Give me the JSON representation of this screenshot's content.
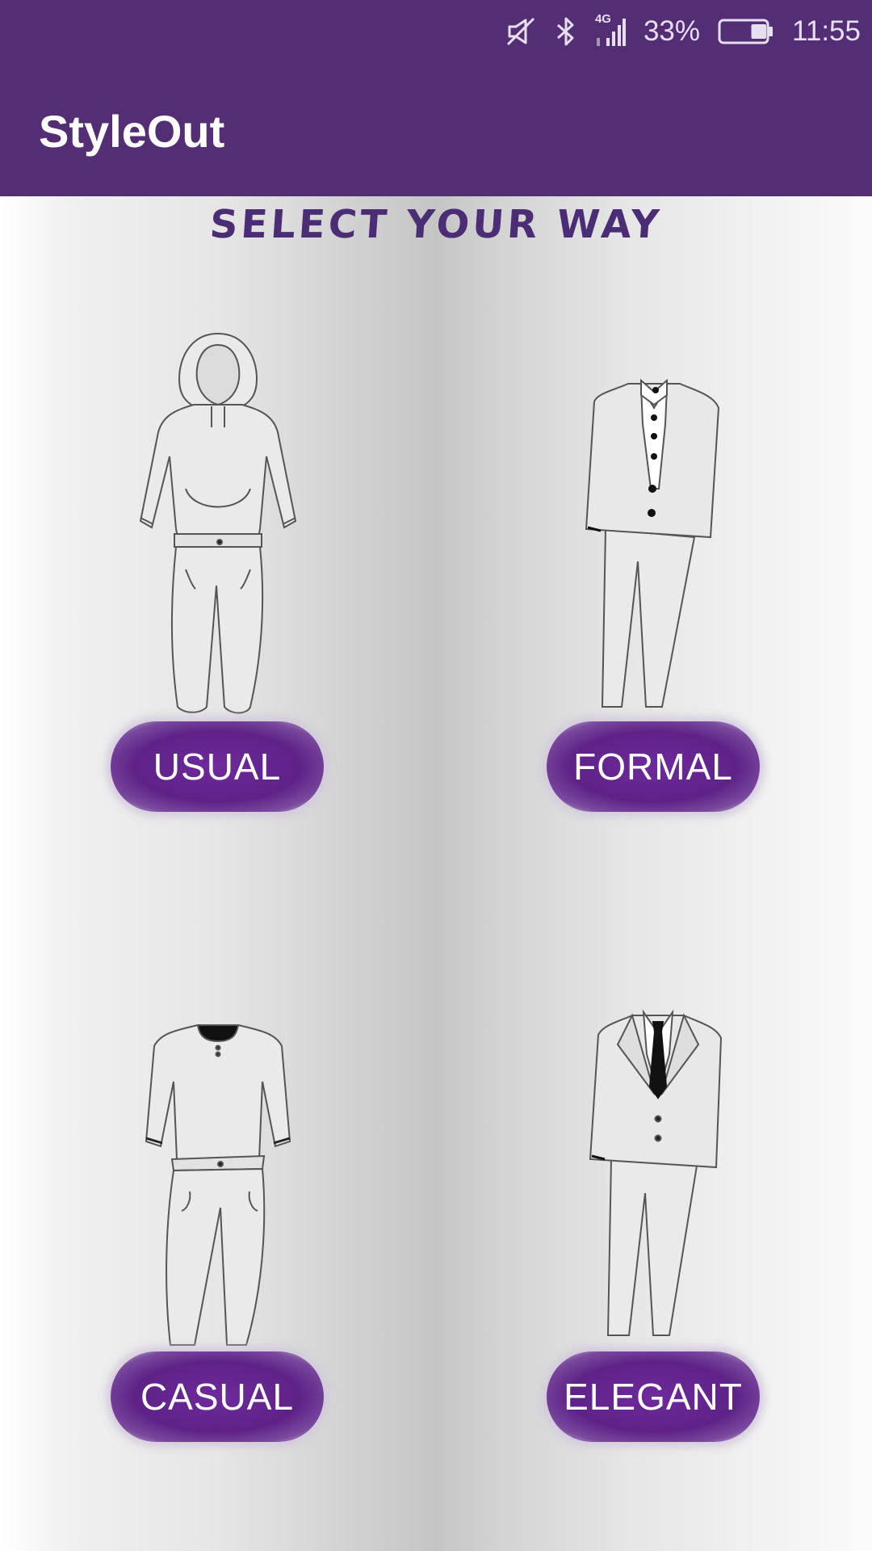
{
  "status_bar": {
    "icons": [
      "mute-icon",
      "bluetooth-icon",
      "signal-4g-icon",
      "battery-icon"
    ],
    "network_label": "4G",
    "battery_percent": "33%",
    "battery_level": 0.33,
    "time": "11:55"
  },
  "app_bar": {
    "title": "StyleOut"
  },
  "main": {
    "headline": "SELECT YOUR WAY",
    "styles": [
      {
        "label": "USUAL",
        "icon": "hoodie-outfit-icon"
      },
      {
        "label": "FORMAL",
        "icon": "formal-suit-icon"
      },
      {
        "label": "CASUAL",
        "icon": "casual-outfit-icon"
      },
      {
        "label": "ELEGANT",
        "icon": "tie-suit-icon"
      }
    ]
  },
  "colors": {
    "primary": "#532e74",
    "headline": "#4a2d75",
    "button": "#5e2287",
    "button_text": "#ffffff"
  }
}
